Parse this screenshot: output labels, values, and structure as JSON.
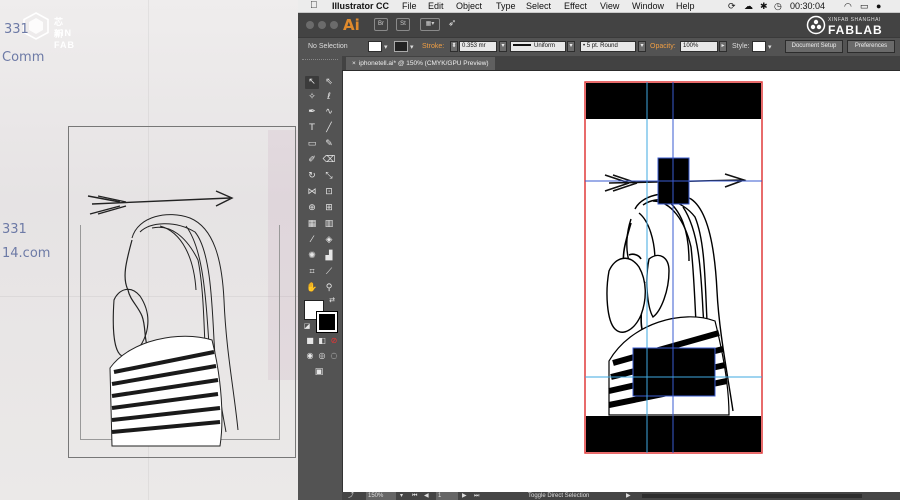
{
  "photo": {
    "logo": {
      "line1": "芯 XIN",
      "line2": "新 FAB"
    },
    "scribbles": [
      "331",
      "Comm",
      "331",
      "14.com"
    ]
  },
  "menubar": {
    "app_name": "Illustrator CC",
    "items": [
      "File",
      "Edit",
      "Object",
      "Type",
      "Select",
      "Effect",
      "View",
      "Window",
      "Help"
    ],
    "clock": "00:30:04"
  },
  "appbar": {
    "app_icon": "Ai",
    "br_icon": "Br",
    "st_icon": "St",
    "brand": {
      "small": "XINFAB SHANGHAI",
      "big": "FABLAB"
    }
  },
  "control": {
    "selection": "No Selection",
    "stroke_label": "Stroke:",
    "stroke_value": "0.353 mr",
    "profile": "Uniform",
    "brush": "5 pt. Round",
    "opacity_label": "Opacity:",
    "opacity_value": "100%",
    "style_label": "Style:",
    "doc_setup": "Document Setup",
    "preferences": "Preferences"
  },
  "document": {
    "tab_title": "iphonetell.ai* @ 150% (CMYK/GPU Preview)"
  },
  "status": {
    "zoom": "150%",
    "page": "1",
    "tool_hint": "Toggle Direct Selection"
  },
  "colors": {
    "artboard_border": "#e03a3a",
    "guide": "#3fa8e0",
    "selection": "#3a5bd0"
  }
}
